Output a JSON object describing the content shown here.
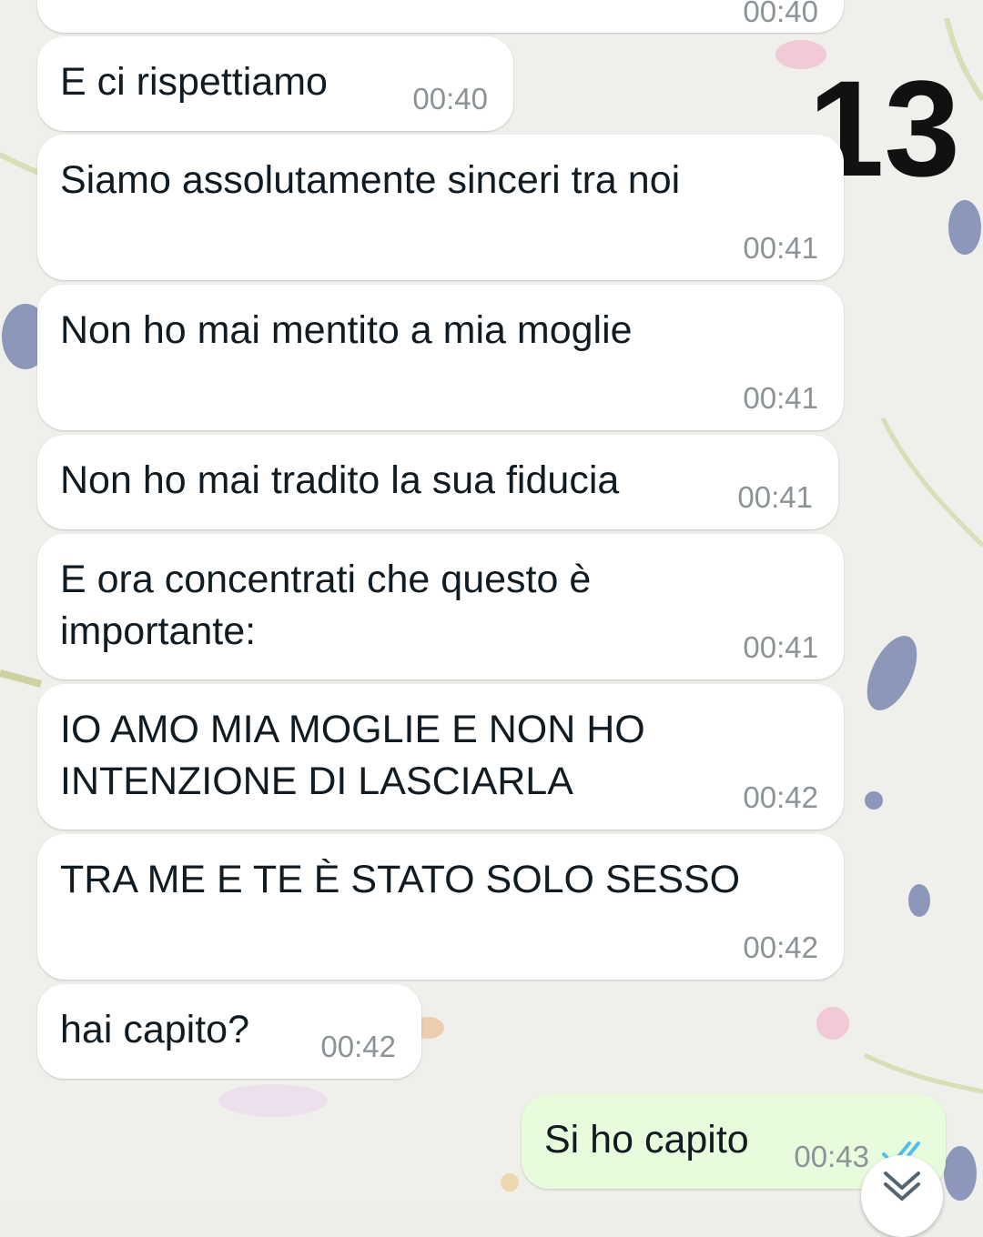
{
  "chat": {
    "messages": [
      {
        "text": "",
        "time": "00:40",
        "direction": "incoming"
      },
      {
        "text": "E ci rispettiamo",
        "time": "00:40",
        "direction": "incoming"
      },
      {
        "text": "Siamo assolutamente sinceri tra noi",
        "time": "00:41",
        "direction": "incoming"
      },
      {
        "text": "Non ho mai mentito a mia moglie",
        "time": "00:41",
        "direction": "incoming"
      },
      {
        "text": "Non ho mai tradito la sua fiducia",
        "time": "00:41",
        "direction": "incoming"
      },
      {
        "text": "E ora concentrati che questo è\nimportante:",
        "time": "00:41",
        "direction": "incoming"
      },
      {
        "text": "IO AMO MIA MOGLIE E NON HO\nINTENZIONE DI LASCIARLA",
        "time": "00:42",
        "direction": "incoming"
      },
      {
        "text": "TRA ME E TE È STATO SOLO SESSO",
        "time": "00:42",
        "direction": "incoming"
      },
      {
        "text": "hai capito?",
        "time": "00:42",
        "direction": "incoming"
      },
      {
        "text": "Si ho capito",
        "time": "00:43",
        "direction": "outgoing",
        "status": "read"
      }
    ]
  },
  "overlay": {
    "page_number": "13"
  },
  "icons": {
    "read_receipt": "double-check-icon",
    "scroll": "chevron-double-down-icon"
  },
  "colors": {
    "incoming_bubble": "#ffffff",
    "outgoing_bubble": "#e7fcdc",
    "timestamp": "#8c9397",
    "read_tick": "#53bdeb",
    "text": "#111b21"
  }
}
